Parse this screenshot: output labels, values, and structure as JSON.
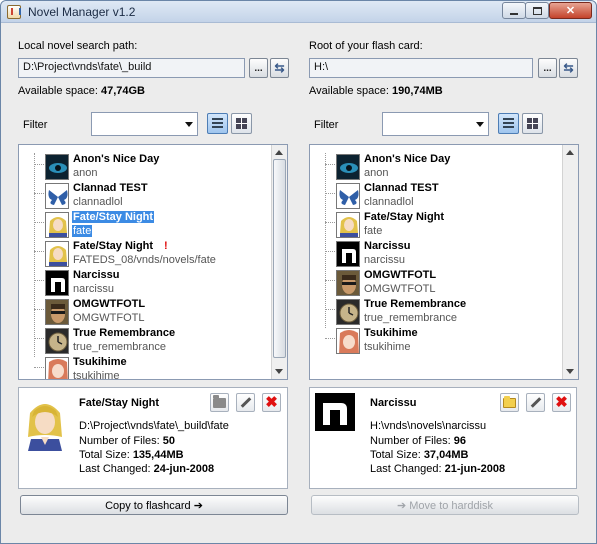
{
  "window": {
    "title": "Novel Manager v1.2"
  },
  "left": {
    "path_label": "Local novel search path:",
    "path_value": "D:\\Project\\vnds\\fate\\_build",
    "browse_label": "...",
    "space_label": "Available space:",
    "space_value": "47,74GB",
    "filter_label": "Filter",
    "filter_value": "",
    "items": [
      {
        "title": "Anon's Nice Day",
        "sub": "anon",
        "icon": "eye-icon"
      },
      {
        "title": "Clannad TEST",
        "sub": "clannadlol",
        "icon": "butterfly-icon"
      },
      {
        "title": "Fate/Stay Night",
        "sub": "fate",
        "icon": "saber-portrait-icon",
        "selected": true
      },
      {
        "title": "Fate/Stay Night",
        "sub": "FATEDS_08/vnds/novels/fate",
        "icon": "saber-portrait-icon",
        "warn": "!"
      },
      {
        "title": "Narcissu",
        "sub": "narcissu",
        "icon": "n-logo-icon"
      },
      {
        "title": "OMGWTFOTL",
        "sub": "OMGWTFOTL",
        "icon": "face-portrait-icon"
      },
      {
        "title": "True Remembrance",
        "sub": "true_remembrance",
        "icon": "clock-icon"
      },
      {
        "title": "Tsukihime",
        "sub": "tsukihime",
        "icon": "girl-portrait-icon"
      }
    ],
    "details": {
      "title": "Fate/Stay Night",
      "path": "D:\\Project\\vnds\\fate\\_build\\fate",
      "files_label": "Number of Files:",
      "files": "50",
      "size_label": "Total Size:",
      "size": "135,44MB",
      "changed_label": "Last Changed:",
      "changed": "24-jun-2008"
    },
    "action_label": "Copy to flashcard ➔"
  },
  "right": {
    "path_label": "Root of your flash card:",
    "path_value": "H:\\",
    "browse_label": "...",
    "space_label": "Available space:",
    "space_value": "190,74MB",
    "filter_label": "Filter",
    "filter_value": "",
    "items": [
      {
        "title": "Anon's Nice Day",
        "sub": "anon",
        "icon": "eye-icon"
      },
      {
        "title": "Clannad TEST",
        "sub": "clannadlol",
        "icon": "butterfly-icon"
      },
      {
        "title": "Fate/Stay Night",
        "sub": "fate",
        "icon": "saber-portrait-icon"
      },
      {
        "title": "Narcissu",
        "sub": "narcissu",
        "icon": "n-logo-icon"
      },
      {
        "title": "OMGWTFOTL",
        "sub": "OMGWTFOTL",
        "icon": "face-portrait-icon"
      },
      {
        "title": "True Remembrance",
        "sub": "true_remembrance",
        "icon": "clock-icon"
      },
      {
        "title": "Tsukihime",
        "sub": "tsukihime",
        "icon": "girl-portrait-icon"
      }
    ],
    "details": {
      "title": "Narcissu",
      "path": "H:\\vnds\\novels\\narcissu",
      "files_label": "Number of Files:",
      "files": "96",
      "size_label": "Total Size:",
      "size": "37,04MB",
      "changed_label": "Last Changed:",
      "changed": "21-jun-2008"
    },
    "action_label": "➔ Move to harddisk"
  },
  "colors": {
    "selection": "#3c8be4",
    "warning": "#e01010",
    "window_border": "#6b86a8"
  }
}
